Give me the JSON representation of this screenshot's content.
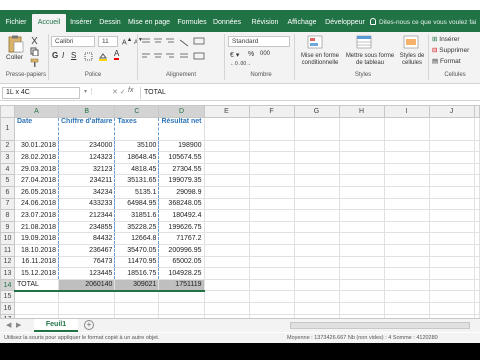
{
  "tabs": [
    "Fichier",
    "Accueil",
    "Insérer",
    "Dessin",
    "Mise en page",
    "Formules",
    "Données",
    "Révision",
    "Affichage",
    "Développeur"
  ],
  "tell_me": "Dites-nous ce que vous voulez fai",
  "ribbon": {
    "paste_label": "Coller",
    "clipboard_label": "Presse-papiers",
    "font_name": "Calibri",
    "font_size": "11",
    "font_label": "Police",
    "alignment_label": "Alignement",
    "number_format": "Standard",
    "percent": "%",
    "thousands": "000",
    "number_label": "Nombre",
    "cond_format": "Mise en forme conditionnelle",
    "format_table": "Mettre sous forme de tableau",
    "cell_styles": "Styles de cellules",
    "styles_label": "Styles",
    "insert": "Insérer",
    "delete": "Supprimer",
    "format": "Format",
    "cells_label": "Cellules"
  },
  "formula_bar": {
    "name_box": "1L x 4C",
    "fx": "fx",
    "value": "TOTAL"
  },
  "columns": [
    "A",
    "B",
    "C",
    "D",
    "E",
    "F",
    "G",
    "H",
    "I",
    "J"
  ],
  "headers": {
    "date": "Date",
    "ca": "Chiffre d'affaire",
    "taxes": "Taxes",
    "net": "Résultat net"
  },
  "rows": [
    {
      "date": "30.01.2018",
      "ca": "234000",
      "taxes": "35100",
      "net": "198900"
    },
    {
      "date": "28.02.2018",
      "ca": "124323",
      "taxes": "18648.45",
      "net": "105674.55"
    },
    {
      "date": "29.03.2018",
      "ca": "32123",
      "taxes": "4818.45",
      "net": "27304.55"
    },
    {
      "date": "27.04.2018",
      "ca": "234211",
      "taxes": "35131.65",
      "net": "199079.35"
    },
    {
      "date": "26.05.2018",
      "ca": "34234",
      "taxes": "5135.1",
      "net": "29098.9"
    },
    {
      "date": "24.06.2018",
      "ca": "433233",
      "taxes": "64984.95",
      "net": "368248.05"
    },
    {
      "date": "23.07.2018",
      "ca": "212344",
      "taxes": "31851.6",
      "net": "180492.4"
    },
    {
      "date": "21.08.2018",
      "ca": "234855",
      "taxes": "35228.25",
      "net": "199626.75"
    },
    {
      "date": "19.09.2018",
      "ca": "84432",
      "taxes": "12664.8",
      "net": "71767.2"
    },
    {
      "date": "18.10.2018",
      "ca": "236467",
      "taxes": "35470.05",
      "net": "200996.95"
    },
    {
      "date": "16.11.2018",
      "ca": "76473",
      "taxes": "11470.95",
      "net": "65002.05"
    },
    {
      "date": "15.12.2018",
      "ca": "123445",
      "taxes": "18516.75",
      "net": "104928.25"
    }
  ],
  "total": {
    "label": "TOTAL",
    "ca": "2060140",
    "taxes": "309021",
    "net": "1751119"
  },
  "row_numbers": [
    "1",
    "2",
    "3",
    "4",
    "5",
    "6",
    "7",
    "8",
    "9",
    "10",
    "11",
    "12",
    "13",
    "14",
    "15",
    "16",
    "17",
    "18"
  ],
  "sheet_tab": "Feuil1",
  "status": {
    "message": "Utilisez la souris pour appliquer le format copié à un autre objet.",
    "summary": "Moyenne : 1373426.667    Nb (non vides) : 4    Somme : 4120280"
  }
}
